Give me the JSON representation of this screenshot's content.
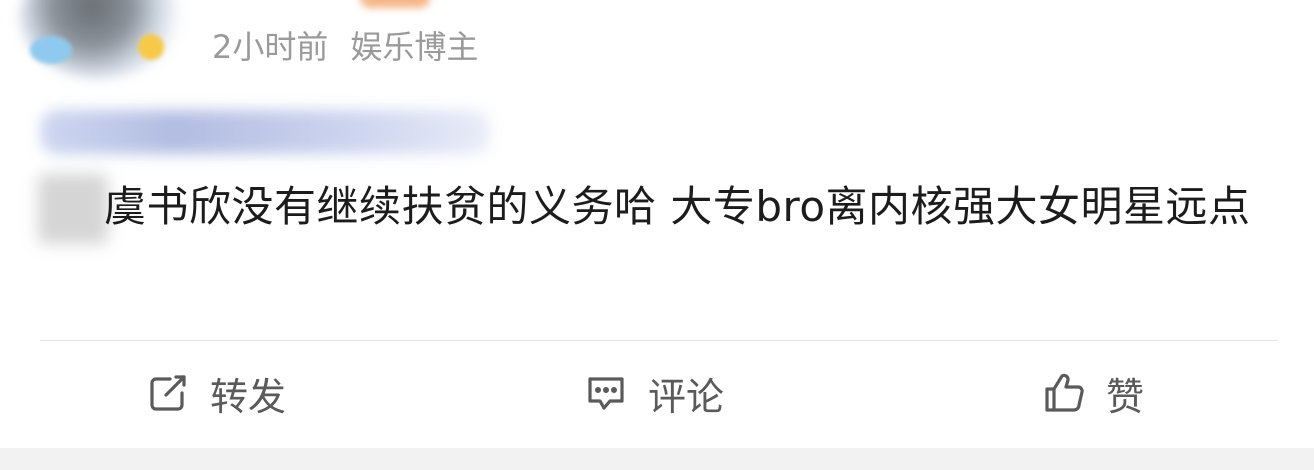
{
  "post": {
    "meta": {
      "time": "2小时前",
      "tag": "娱乐博主"
    },
    "text": "虞书欣没有继续扶贫的义务哈 大专bro离内核强大女明星远点"
  },
  "actions": {
    "repost_label": "转发",
    "comment_label": "评论",
    "like_label": "赞"
  },
  "icons": {
    "repost": "share-square-arrow-icon",
    "comment": "speech-bubble-icon",
    "like": "thumbs-up-icon"
  },
  "colors": {
    "text": "#1c1c1c",
    "meta": "#9a9a9a",
    "action": "#5a5a5a",
    "divider": "#e6e6e6"
  }
}
